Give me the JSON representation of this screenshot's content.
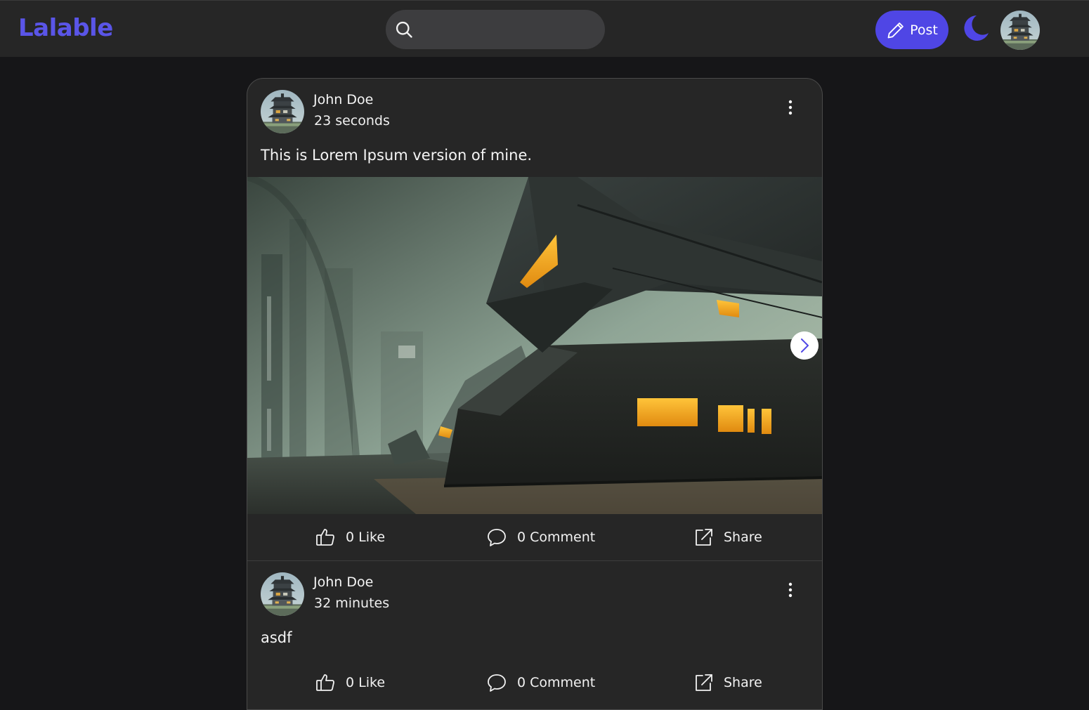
{
  "app": {
    "name": "Lalable",
    "brand_color": "#4f46e5",
    "logo_color": "#5a55e8"
  },
  "header": {
    "search": {
      "placeholder": "",
      "icon": "search-icon"
    },
    "post_button": {
      "label": "Post",
      "icon": "pencil-icon"
    },
    "theme_toggle": {
      "icon": "moon-icon"
    },
    "profile": {
      "icon": "user-avatar"
    }
  },
  "posts": [
    {
      "author": "John Doe",
      "time": "23 seconds",
      "text": "This is Lorem Ipsum version of mine.",
      "has_image": true,
      "image_description_icon": "futuristic-building-image",
      "carousel_next_icon": "chevron-right-icon",
      "likes_label": "0 Like",
      "comments_label": "0 Comment",
      "share_label": "Share"
    },
    {
      "author": "John Doe",
      "time": "32 minutes",
      "text": "asdf",
      "has_image": false,
      "likes_label": "0 Like",
      "comments_label": "0 Comment",
      "share_label": "Share"
    }
  ]
}
